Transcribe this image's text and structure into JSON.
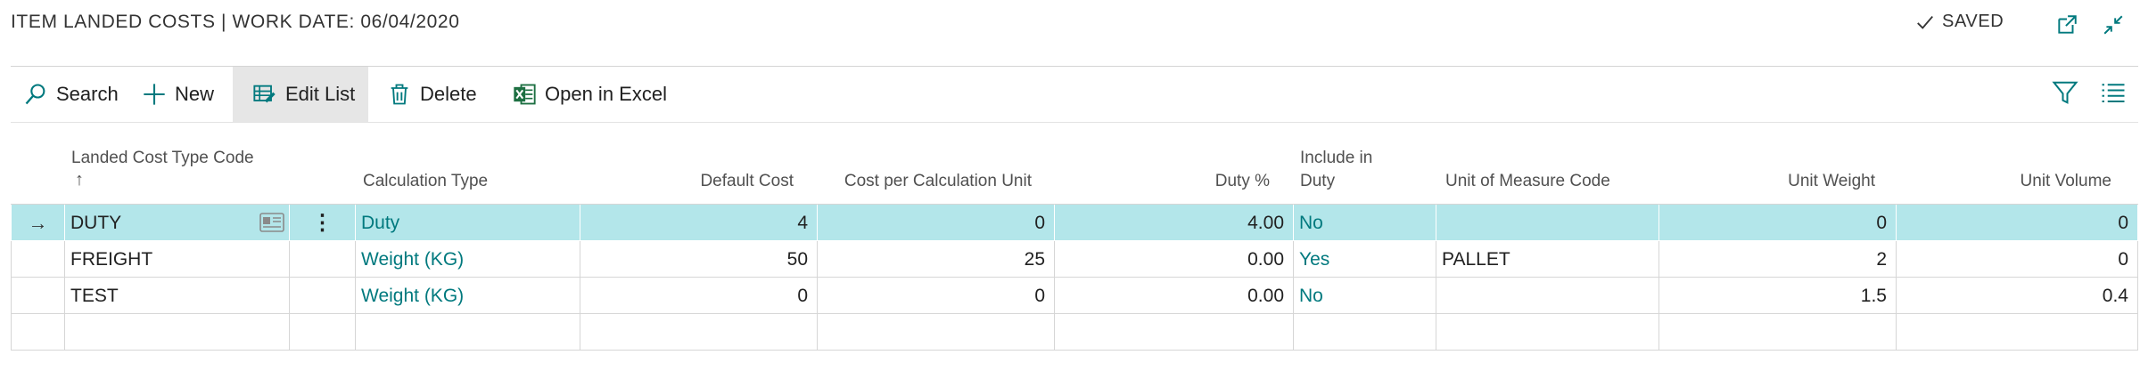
{
  "header": {
    "title": "ITEM LANDED COSTS | WORK DATE: 06/04/2020",
    "saved_label": "SAVED"
  },
  "toolbar": {
    "search_label": "Search",
    "new_label": "New",
    "edit_list_label": "Edit List",
    "delete_label": "Delete",
    "open_excel_label": "Open in Excel"
  },
  "columns": {
    "code": "Landed Cost Type Code",
    "code_sort": "↑",
    "calc_type": "Calculation Type",
    "default_cost": "Default Cost",
    "cost_per_unit": "Cost per Calculation Unit",
    "duty_pct": "Duty %",
    "include_duty_line1": "Include in",
    "include_duty_line2": "Duty",
    "uom": "Unit of Measure Code",
    "unit_weight": "Unit Weight",
    "unit_volume": "Unit Volume"
  },
  "rows": [
    {
      "indicator": "→",
      "code": "DUTY",
      "calc_type": "Duty",
      "default_cost": "4",
      "cost_per_unit": "0",
      "duty_pct": "4.00",
      "include_duty": "No",
      "uom": "",
      "unit_weight": "0",
      "unit_volume": "0"
    },
    {
      "indicator": "",
      "code": "FREIGHT",
      "calc_type": "Weight (KG)",
      "default_cost": "50",
      "cost_per_unit": "25",
      "duty_pct": "0.00",
      "include_duty": "Yes",
      "uom": "PALLET",
      "unit_weight": "2",
      "unit_volume": "0"
    },
    {
      "indicator": "",
      "code": "TEST",
      "calc_type": "Weight (KG)",
      "default_cost": "0",
      "cost_per_unit": "0",
      "duty_pct": "0.00",
      "include_duty": "No",
      "uom": "",
      "unit_weight": "1.5",
      "unit_volume": "0.4"
    },
    {
      "indicator": "",
      "code": "",
      "calc_type": "",
      "default_cost": "",
      "cost_per_unit": "",
      "duty_pct": "",
      "include_duty": "",
      "uom": "",
      "unit_weight": "",
      "unit_volume": ""
    }
  ],
  "row_actions": {
    "more": "⋮"
  },
  "colors": {
    "accent": "#00797e",
    "selected_row": "#b3e6ea",
    "excel_green": "#1d6f42"
  }
}
